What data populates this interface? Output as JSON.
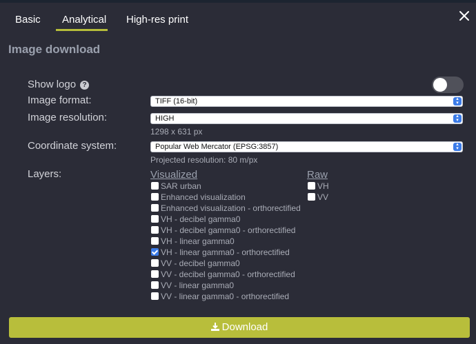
{
  "tabs": [
    {
      "label": "Basic"
    },
    {
      "label": "Analytical",
      "active": true
    },
    {
      "label": "High-res print"
    }
  ],
  "section_title": "Image download",
  "show_logo": {
    "label": "Show logo",
    "enabled": false
  },
  "image_format": {
    "label": "Image format:",
    "value": "TIFF (16-bit)"
  },
  "image_resolution": {
    "label": "Image resolution:",
    "value": "HIGH",
    "dimensions": "1298 x 631 px"
  },
  "coordinate_system": {
    "label": "Coordinate system:",
    "value": "Popular Web Mercator (EPSG:3857)",
    "projected": "Projected resolution: 80 m/px"
  },
  "layers": {
    "label": "Layers:",
    "visualized_heading": "Visualized",
    "raw_heading": "Raw",
    "visualized": [
      {
        "label": "SAR urban",
        "checked": false
      },
      {
        "label": "Enhanced visualization",
        "checked": false
      },
      {
        "label": "Enhanced visualization - orthorectified",
        "checked": false
      },
      {
        "label": "VH - decibel gamma0",
        "checked": false
      },
      {
        "label": "VH - decibel gamma0 - orthorectified",
        "checked": false
      },
      {
        "label": "VH - linear gamma0",
        "checked": false
      },
      {
        "label": "VH - linear gamma0 - orthorectified",
        "checked": true
      },
      {
        "label": "VV - decibel gamma0",
        "checked": false
      },
      {
        "label": "VV - decibel gamma0 - orthorectified",
        "checked": false
      },
      {
        "label": "VV - linear gamma0",
        "checked": false
      },
      {
        "label": "VV - linear gamma0 - orthorectified",
        "checked": false
      }
    ],
    "raw": [
      {
        "label": "VH",
        "checked": false
      },
      {
        "label": "VV",
        "checked": false
      }
    ]
  },
  "download_label": "Download",
  "colors": {
    "accent": "#b8be3b",
    "background": "#2b2c37",
    "checkbox_checked": "#3b7be8"
  }
}
